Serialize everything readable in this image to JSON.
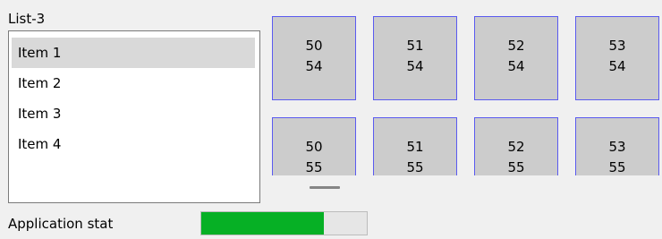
{
  "list": {
    "title": "List-3",
    "items": [
      {
        "label": "Item 1",
        "selected": true
      },
      {
        "label": "Item 2",
        "selected": false
      },
      {
        "label": "Item 3",
        "selected": false
      },
      {
        "label": "Item 4",
        "selected": false
      }
    ]
  },
  "tiles": {
    "rows": [
      [
        {
          "line1": "50",
          "line2": "54"
        },
        {
          "line1": "51",
          "line2": "54"
        },
        {
          "line1": "52",
          "line2": "54"
        },
        {
          "line1": "53",
          "line2": "54"
        }
      ],
      [
        {
          "line1": "50",
          "line2": "55"
        },
        {
          "line1": "51",
          "line2": "55"
        },
        {
          "line1": "52",
          "line2": "55"
        },
        {
          "line1": "53",
          "line2": "55"
        }
      ]
    ]
  },
  "status": {
    "label": "Application stat",
    "progress_fraction": 0.74
  },
  "colors": {
    "progress_fill": "#06b025",
    "tile_border": "#5a5af0",
    "tile_background": "#cccccc",
    "selected_item": "#d9d9d9"
  }
}
